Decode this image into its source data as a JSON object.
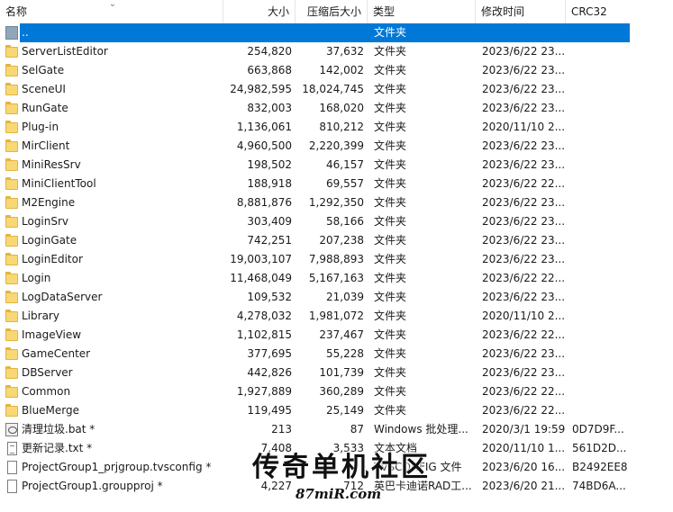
{
  "header": {
    "name": "名称",
    "size": "大小",
    "packed_size": "压缩后大小",
    "type": "类型",
    "modified": "修改时间",
    "crc": "CRC32"
  },
  "rows": [
    {
      "icon": "up-icon",
      "name": "..",
      "size": "",
      "packed": "",
      "type": "文件夹",
      "modified": "",
      "crc": "",
      "selected": true
    },
    {
      "icon": "folder-icon",
      "name": "ServerListEditor",
      "size": "254,820",
      "packed": "37,632",
      "type": "文件夹",
      "modified": "2023/6/22 23...",
      "crc": ""
    },
    {
      "icon": "folder-icon",
      "name": "SelGate",
      "size": "663,868",
      "packed": "142,002",
      "type": "文件夹",
      "modified": "2023/6/22 23...",
      "crc": ""
    },
    {
      "icon": "folder-icon",
      "name": "SceneUI",
      "size": "24,982,595",
      "packed": "18,024,745",
      "type": "文件夹",
      "modified": "2023/6/22 23...",
      "crc": ""
    },
    {
      "icon": "folder-icon",
      "name": "RunGate",
      "size": "832,003",
      "packed": "168,020",
      "type": "文件夹",
      "modified": "2023/6/22 23...",
      "crc": ""
    },
    {
      "icon": "folder-icon",
      "name": "Plug-in",
      "size": "1,136,061",
      "packed": "810,212",
      "type": "文件夹",
      "modified": "2020/11/10 2...",
      "crc": ""
    },
    {
      "icon": "folder-icon",
      "name": "MirClient",
      "size": "4,960,500",
      "packed": "2,220,399",
      "type": "文件夹",
      "modified": "2023/6/22 23...",
      "crc": ""
    },
    {
      "icon": "folder-icon",
      "name": "MiniResSrv",
      "size": "198,502",
      "packed": "46,157",
      "type": "文件夹",
      "modified": "2023/6/22 23...",
      "crc": ""
    },
    {
      "icon": "folder-icon",
      "name": "MiniClientTool",
      "size": "188,918",
      "packed": "69,557",
      "type": "文件夹",
      "modified": "2023/6/22 22...",
      "crc": ""
    },
    {
      "icon": "folder-icon",
      "name": "M2Engine",
      "size": "8,881,876",
      "packed": "1,292,350",
      "type": "文件夹",
      "modified": "2023/6/22 23...",
      "crc": ""
    },
    {
      "icon": "folder-icon",
      "name": "LoginSrv",
      "size": "303,409",
      "packed": "58,166",
      "type": "文件夹",
      "modified": "2023/6/22 23...",
      "crc": ""
    },
    {
      "icon": "folder-icon",
      "name": "LoginGate",
      "size": "742,251",
      "packed": "207,238",
      "type": "文件夹",
      "modified": "2023/6/22 23...",
      "crc": ""
    },
    {
      "icon": "folder-icon",
      "name": "LoginEditor",
      "size": "19,003,107",
      "packed": "7,988,893",
      "type": "文件夹",
      "modified": "2023/6/22 23...",
      "crc": ""
    },
    {
      "icon": "folder-icon",
      "name": "Login",
      "size": "11,468,049",
      "packed": "5,167,163",
      "type": "文件夹",
      "modified": "2023/6/22 22...",
      "crc": ""
    },
    {
      "icon": "folder-icon",
      "name": "LogDataServer",
      "size": "109,532",
      "packed": "21,039",
      "type": "文件夹",
      "modified": "2023/6/22 23...",
      "crc": ""
    },
    {
      "icon": "folder-icon",
      "name": "Library",
      "size": "4,278,032",
      "packed": "1,981,072",
      "type": "文件夹",
      "modified": "2020/11/10 2...",
      "crc": ""
    },
    {
      "icon": "folder-icon",
      "name": "ImageView",
      "size": "1,102,815",
      "packed": "237,467",
      "type": "文件夹",
      "modified": "2023/6/22 22...",
      "crc": ""
    },
    {
      "icon": "folder-icon",
      "name": "GameCenter",
      "size": "377,695",
      "packed": "55,228",
      "type": "文件夹",
      "modified": "2023/6/22 23...",
      "crc": ""
    },
    {
      "icon": "folder-icon",
      "name": "DBServer",
      "size": "442,826",
      "packed": "101,739",
      "type": "文件夹",
      "modified": "2023/6/22 23...",
      "crc": ""
    },
    {
      "icon": "folder-icon",
      "name": "Common",
      "size": "1,927,889",
      "packed": "360,289",
      "type": "文件夹",
      "modified": "2023/6/22 22...",
      "crc": ""
    },
    {
      "icon": "folder-icon",
      "name": "BlueMerge",
      "size": "119,495",
      "packed": "25,149",
      "type": "文件夹",
      "modified": "2023/6/22 22...",
      "crc": ""
    },
    {
      "icon": "bat-icon",
      "name": "清理垃圾.bat *",
      "size": "213",
      "packed": "87",
      "type": "Windows 批处理...",
      "modified": "2020/3/1 19:59",
      "crc": "0D7D9F..."
    },
    {
      "icon": "file-icon lined",
      "name": "更新记录.txt *",
      "size": "7,408",
      "packed": "3,533",
      "type": "文本文档",
      "modified": "2020/11/10 1...",
      "crc": "561D2D..."
    },
    {
      "icon": "file-icon",
      "name": "ProjectGroup1_prjgroup.tvsconfig *",
      "size": "",
      "packed": "",
      "type": "TVSCONFIG 文件",
      "modified": "2023/6/20 16...",
      "crc": "B2492EE8"
    },
    {
      "icon": "file-icon",
      "name": "ProjectGroup1.groupproj *",
      "size": "4,227",
      "packed": "712",
      "type": "英巴卡迪诺RAD工...",
      "modified": "2023/6/20 21...",
      "crc": "74BD6A..."
    }
  ],
  "watermark": {
    "title": "传奇单机社区",
    "site": "87miR.com"
  }
}
